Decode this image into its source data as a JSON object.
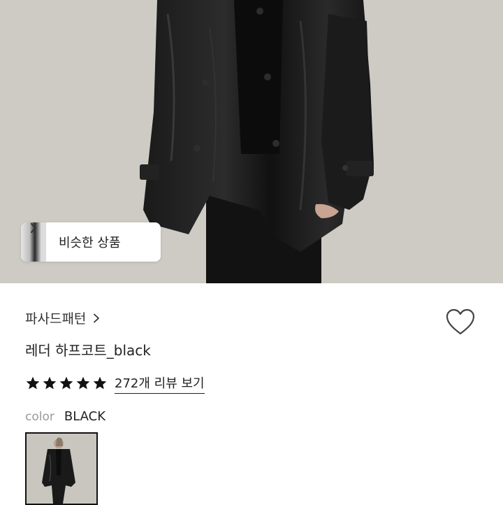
{
  "hero": {
    "image_subject": "black leather half coat product photo",
    "similar_button": {
      "label": "비슷한 상품",
      "icon": "chevron-right-icon"
    }
  },
  "product": {
    "brand": "파사드패턴",
    "brand_icon": "chevron-right-icon",
    "name": "레더 하프코트_black",
    "wishlist_icon": "heart-outline-icon",
    "rating": {
      "stars": 5,
      "max": 5,
      "star_color": "#111111"
    },
    "reviews_label": "272개 리뷰 보기",
    "color_key": "color",
    "color_value": "BLACK",
    "swatch_subject": "black leather half coat thumbnail"
  }
}
